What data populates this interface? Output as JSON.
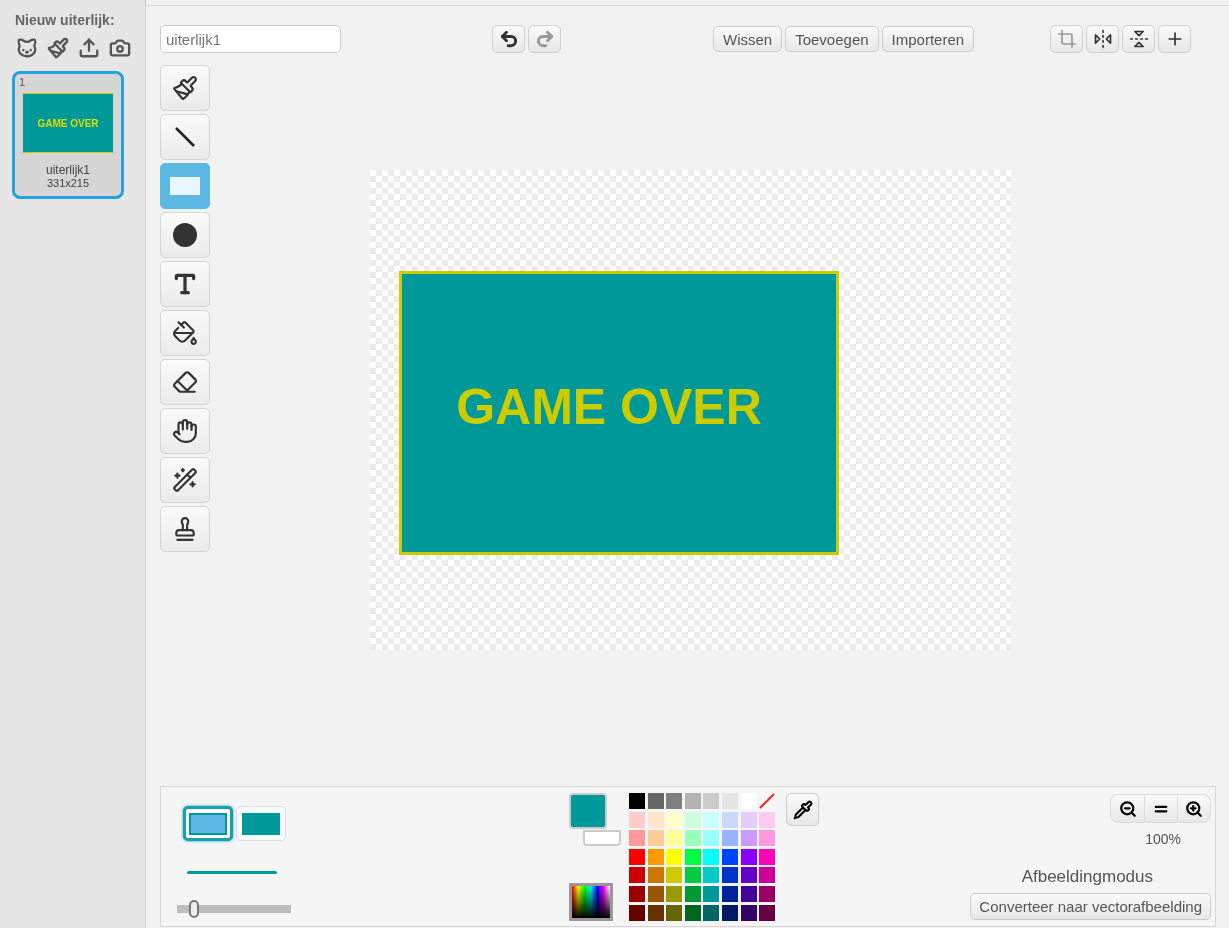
{
  "sidebar": {
    "title": "Nieuw uiterlijk:",
    "new_buttons": [
      {
        "kind": "sprite"
      },
      {
        "kind": "paint"
      },
      {
        "kind": "upload"
      },
      {
        "kind": "camera"
      }
    ],
    "costumes": [
      {
        "number": "1",
        "thumb_text": "GAME OVER",
        "name": "uiterlijk1",
        "size": "331x215",
        "selected": true
      }
    ]
  },
  "toolbar": {
    "name_field": {
      "value": "uiterlijk1"
    },
    "undo": {
      "disabled": false
    },
    "redo": {
      "disabled": true
    },
    "buttons": [
      "Wissen",
      "Toevoegen",
      "Importeren"
    ],
    "transform_buttons": [
      {
        "kind": "crop"
      },
      {
        "kind": "flip-h"
      },
      {
        "kind": "flip-v"
      },
      {
        "kind": "center"
      }
    ]
  },
  "tools": [
    {
      "kind": "brush",
      "selected": false
    },
    {
      "kind": "line",
      "selected": false
    },
    {
      "kind": "rectangle",
      "selected": true
    },
    {
      "kind": "ellipse",
      "selected": false
    },
    {
      "kind": "text",
      "selected": false
    },
    {
      "kind": "fill",
      "selected": false
    },
    {
      "kind": "eraser",
      "selected": false
    },
    {
      "kind": "select",
      "selected": false
    },
    {
      "kind": "magic",
      "selected": false
    },
    {
      "kind": "stamp",
      "selected": false
    }
  ],
  "canvas": {
    "text": "GAME OVER"
  },
  "bottom": {
    "fill_modes": [
      {
        "kind": "outline",
        "selected": true
      },
      {
        "kind": "solid",
        "selected": false
      }
    ],
    "stroke_width": {
      "level": 0.12
    },
    "primary_color": {
      "color": "#009999"
    },
    "secondary_color": {
      "color": "#ffffff"
    },
    "swatches": [
      {
        "kind": "color",
        "color": "#000000"
      },
      {
        "kind": "color",
        "color": "#666666"
      },
      {
        "kind": "color",
        "color": "#808080"
      },
      {
        "kind": "color",
        "color": "#b3b3b3"
      },
      {
        "kind": "color",
        "color": "#cccccc"
      },
      {
        "kind": "color",
        "color": "#e6e6e6"
      },
      {
        "kind": "color",
        "color": "#ffffff"
      },
      {
        "kind": "none"
      },
      {
        "kind": "color",
        "color": "#ffcccc"
      },
      {
        "kind": "color",
        "color": "#ffe6cc"
      },
      {
        "kind": "color",
        "color": "#ffffcc"
      },
      {
        "kind": "color",
        "color": "#ccffdd"
      },
      {
        "kind": "color",
        "color": "#ccffff"
      },
      {
        "kind": "color",
        "color": "#ccd9ff"
      },
      {
        "kind": "color",
        "color": "#e6ccff"
      },
      {
        "kind": "color",
        "color": "#ffccee"
      },
      {
        "kind": "color",
        "color": "#ff9999"
      },
      {
        "kind": "color",
        "color": "#ffcc99"
      },
      {
        "kind": "color",
        "color": "#ffff99"
      },
      {
        "kind": "color",
        "color": "#99ffbb"
      },
      {
        "kind": "color",
        "color": "#99ffff"
      },
      {
        "kind": "color",
        "color": "#99b3ff"
      },
      {
        "kind": "color",
        "color": "#cc99ff"
      },
      {
        "kind": "color",
        "color": "#ff99dd"
      },
      {
        "kind": "color",
        "color": "#ff0000"
      },
      {
        "kind": "color",
        "color": "#ff9900"
      },
      {
        "kind": "color",
        "color": "#ffff00"
      },
      {
        "kind": "color",
        "color": "#00ff44"
      },
      {
        "kind": "color",
        "color": "#00ffff"
      },
      {
        "kind": "color",
        "color": "#0044ff"
      },
      {
        "kind": "color",
        "color": "#8800ff"
      },
      {
        "kind": "color",
        "color": "#ff00bb"
      },
      {
        "kind": "color",
        "color": "#cc0000"
      },
      {
        "kind": "color",
        "color": "#cc7700"
      },
      {
        "kind": "color",
        "color": "#cccc00"
      },
      {
        "kind": "color",
        "color": "#00cc44"
      },
      {
        "kind": "color",
        "color": "#00cccc"
      },
      {
        "kind": "color",
        "color": "#0033cc"
      },
      {
        "kind": "color",
        "color": "#6600cc"
      },
      {
        "kind": "color",
        "color": "#cc0099"
      },
      {
        "kind": "color",
        "color": "#990000"
      },
      {
        "kind": "color",
        "color": "#995500"
      },
      {
        "kind": "color",
        "color": "#999900"
      },
      {
        "kind": "color",
        "color": "#009933"
      },
      {
        "kind": "color",
        "color": "#009999"
      },
      {
        "kind": "color",
        "color": "#002299"
      },
      {
        "kind": "color",
        "color": "#440099"
      },
      {
        "kind": "color",
        "color": "#990066"
      },
      {
        "kind": "color",
        "color": "#660000"
      },
      {
        "kind": "color",
        "color": "#663300"
      },
      {
        "kind": "color",
        "color": "#666600"
      },
      {
        "kind": "color",
        "color": "#006622"
      },
      {
        "kind": "color",
        "color": "#006666"
      },
      {
        "kind": "color",
        "color": "#001a66"
      },
      {
        "kind": "color",
        "color": "#330066"
      },
      {
        "kind": "color",
        "color": "#660044"
      }
    ],
    "zoom": "100%",
    "mode_label": "Afbeeldingmodus",
    "convert_button": "Converteer naar vectorafbeelding"
  }
}
